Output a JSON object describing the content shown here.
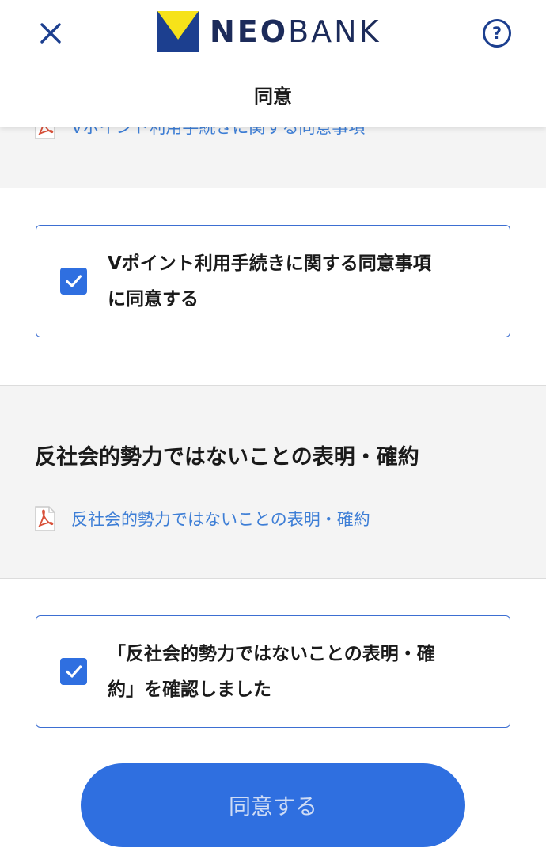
{
  "header": {
    "brand_bold": "NEO",
    "brand_light": "BANK",
    "title": "同意",
    "close_icon": "close-icon",
    "help_icon": "help-circle-icon"
  },
  "sections": [
    {
      "doc_link": "Vポイント利用手続きに関する同意事項"
    },
    {
      "heading": "反社会的勢力ではないことの表明・確約",
      "doc_link": "反社会的勢力ではないことの表明・確約"
    }
  ],
  "checkboxes": [
    {
      "label_line1": "Vポイント利用手続きに関する同意事項",
      "label_line2": "に同意する",
      "checked": true
    },
    {
      "label_line1": "「反社会的勢力ではないことの表明・確",
      "label_line2": "約」を確認しました",
      "checked": true
    }
  ],
  "agree_button": {
    "label": "同意する"
  },
  "colors": {
    "brand_navy": "#1c2b5a",
    "brand_yellow": "#f6e21a",
    "accent_blue": "#2f6fe0",
    "link_blue": "#3d7ed6",
    "pdf_red": "#d8513a"
  }
}
